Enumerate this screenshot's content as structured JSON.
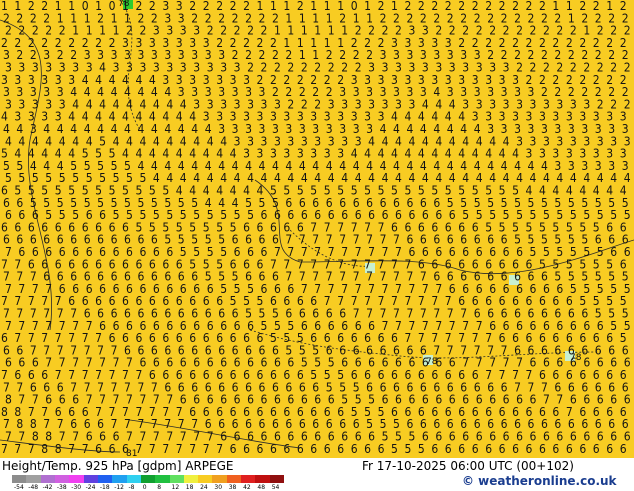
{
  "map": {
    "rows": [
      "1 1 2 2 1 1 0 1 0 1 2 2 3 3 2 2 2 2 2 1 1 1 2 1 1 1 0 1 2 1 2 2 2 2 2 2 2 2 2 2 2 1 1 2 2 1 2",
      "2 2 2 2 1 1 1 2 1 1 2 2 3 3 2 2 2 2 2 2 2 1 1 1 1 2 1 1 2 2 2 2 2 2 2 2 2 2 2 2 2 2 1 2 2 2 2",
      "2 2 2 2 2 1 1 1 1 2 2 3 3 3 3 2 2 2 2 2 1 1 1 1 1 1 2 2 2 2 3 3 2 2 2 2 2 2 2 2 2 2 2 1 2 2 2",
      "2 2 2 2 2 2 2 2 2 3 3 3 3 3 3 3 2 2 2 2 2 1 1 1 1 1 2 2 2 3 3 3 3 3 2 2 2 2 2 2 2 2 2 2 2 2 2",
      "3 2 2 3 2 2 3 3 3 3 3 3 3 3 3 3 3 2 2 2 2 2 1 1 2 2 2 2 3 3 3 3 3 3 3 3 2 2 2 2 2 2 2 2 2 2 2",
      "3 3 3 3 3 3 3 4 3 3 3 3 3 3 3 3 3 3 2 2 2 2 2 2 2 2 2 3 3 3 3 3 3 3 3 3 3 3 2 2 2 2 2 2 2 2 2",
      "3 3 3 3 3 3 4 4 4 4 4 4 3 3 3 3 3 3 3 2 2 2 2 2 2 2 3 3 3 3 3 3 3 3 3 3 3 3 3 2 2 2 2 2 2 2 2",
      "3 3 3 3 3 4 4 4 4 4 4 4 4 3 3 3 3 3 3 3 2 2 2 2 2 3 3 3 3 3 3 3 4 3 3 3 3 3 3 3 2 2 2 2 2 2 2",
      "3 3 3 3 3 4 4 4 4 4 4 4 4 4 3 3 3 3 3 3 3 2 2 2 3 3 3 3 3 3 3 4 4 4 3 3 3 3 3 3 3 3 3 3 2 2 2",
      "4 3 3 3 3 4 4 4 4 4 4 4 4 4 4 3 3 3 3 3 3 3 3 3 3 3 3 3 3 4 4 4 4 4 4 3 3 3 3 3 3 3 3 3 3 3 3",
      "4 4 3 4 4 4 4 4 4 4 4 4 4 4 4 4 3 3 3 3 3 3 3 3 3 3 3 3 4 4 4 4 4 4 4 4 3 3 3 3 3 3 3 3 3 3 3",
      "4 4 4 4 4 4 4 5 4 4 4 4 4 4 4 4 4 3 3 3 3 3 3 3 3 3 3 4 4 4 4 4 4 4 4 4 4 4 3 3 3 3 3 3 3 3 3",
      "5 4 4 4 4 4 5 5 5 4 4 4 4 4 4 4 4 4 3 3 3 3 3 3 3 3 4 4 4 4 4 4 4 4 4 4 4 4 4 3 3 3 3 3 3 3 3",
      "5 5 4 4 4 5 5 5 5 5 4 4 4 4 4 4 4 4 4 4 4 4 4 4 4 4 4 4 4 4 4 4 4 4 4 4 4 4 4 4 4 3 3 3 3 3 3",
      "5 5 5 5 5 5 5 5 5 5 5 4 4 4 4 4 4 4 4 4 4 4 4 4 4 4 4 4 4 4 4 4 4 4 4 4 4 4 4 4 4 4 4 4 4 4 4",
      "6 5 5 5 5 5 5 5 5 5 5 5 5 4 4 4 4 4 4 4 5 5 5 5 5 5 5 5 5 5 5 5 5 5 5 5 5 5 5 4 4 4 4 4 4 4 4",
      "6 6 5 5 5 5 5 5 5 5 5 5 5 5 5 4 4 4 5 5 5 6 6 6 6 6 6 6 6 6 6 6 6 5 5 5 5 5 5 5 5 5 5 5 5 5 5",
      "6 6 6 5 5 5 6 6 5 5 5 5 5 5 5 5 5 5 5 6 6 6 6 6 6 6 6 6 6 6 6 6 6 6 5 5 5 5 5 5 5 5 5 5 5 5 5",
      "6 6 6 6 6 6 6 6 6 6 5 5 5 5 5 5 5 5 6 6 6 6 6 7 7 7 7 7 7 6 6 6 6 6 6 6 5 5 5 5 5 5 5 5 5 6 6",
      "6 6 6 6 6 6 6 6 6 6 6 6 5 5 5 5 5 6 6 6 6 7 7 7 7 7 7 7 7 7 6 6 6 6 6 6 6 6 5 5 5 5 5 5 6 6 6",
      "7 6 6 6 6 6 6 6 6 6 6 6 6 5 5 5 5 6 6 6 7 7 7 7 7 7 7 7 7 7 6 6 6 6 6 6 6 6 6 5 5 5 5 5 5 6 6",
      "7 7 6 6 6 6 6 6 6 6 6 6 6 6 5 5 5 6 6 6 7 7 7 7 7 7 7 7 7 7 7 6 6 6 6 6 6 6 6 6 5 5 5 5 5 5 6",
      "7 7 7 6 6 6 6 6 6 6 6 6 6 6 6 5 5 5 6 6 6 7 7 7 7 7 7 7 7 7 7 7 6 6 6 6 6 6 6 6 6 5 5 5 5 5 5",
      "7 7 7 7 6 6 6 6 6 6 6 6 6 6 6 6 5 5 5 6 6 6 7 7 7 7 7 7 7 7 7 7 7 6 6 6 6 6 6 6 6 6 5 5 5 5 5",
      "7 7 7 7 7 6 6 6 6 6 6 6 6 6 6 6 6 5 5 5 6 6 6 6 7 7 7 7 7 7 7 7 7 7 6 6 6 6 6 6 6 6 6 5 5 5 5",
      "7 7 7 7 7 7 6 6 6 6 6 6 6 6 6 6 6 6 5 5 5 6 6 6 6 6 7 7 7 7 7 7 7 7 7 6 6 6 6 6 6 6 6 6 5 5 5",
      "7 7 7 7 7 7 7 6 6 6 6 6 6 6 6 6 6 6 6 5 5 5 6 6 6 6 6 6 7 7 7 7 7 7 7 7 6 6 6 6 6 6 6 6 6 5 5",
      "6 7 7 7 7 7 7 7 6 6 6 6 6 6 6 6 6 6 6 6 5 5 5 6 6 6 6 6 6 6 7 7 7 7 7 7 7 6 6 6 6 6 6 6 6 6 5",
      "6 6 7 7 7 7 7 7 7 6 6 6 6 6 6 6 6 6 6 6 6 5 5 5 6 6 6 6 6 6 6 6 7 7 7 7 7 7 6 6 6 6 6 6 6 6 6",
      "6 6 6 7 7 7 7 7 7 7 6 6 6 6 6 6 6 6 6 6 6 6 5 5 5 6 6 6 6 6 6 6 6 6 7 7 7 7 7 6 6 6 6 6 6 6 6",
      "7 6 6 6 7 7 7 7 7 7 7 6 6 6 6 6 6 6 6 6 6 6 6 5 5 5 6 6 6 6 6 6 6 6 6 6 7 7 7 7 6 6 6 6 6 6 6",
      "7 7 6 6 6 7 7 7 7 7 7 7 6 6 6 6 6 6 6 6 6 6 6 6 5 5 5 6 6 6 6 6 6 6 6 6 6 6 7 7 7 6 6 6 6 6 6",
      "8 7 7 6 6 6 7 7 7 7 7 7 7 6 6 6 6 6 6 6 6 6 6 6 6 5 5 5 6 6 6 6 6 6 6 6 6 6 6 6 7 7 6 6 6 6 6",
      "8 8 7 7 6 6 6 7 7 7 7 7 7 7 6 6 6 6 6 6 6 6 6 6 6 6 5 5 5 6 6 6 6 6 6 6 6 6 6 6 6 6 7 6 6 6 6",
      "7 8 8 7 7 6 6 6 7 7 7 7 7 7 7 6 6 6 6 6 6 6 6 6 6 6 6 5 5 5 6 6 6 6 6 6 6 6 6 6 6 6 6 6 6 6 6",
      "7 7 8 8 7 7 6 6 6 7 7 7 7 7 7 7 6 6 6 6 6 6 6 6 6 6 6 6 5 5 5 6 6 6 6 6 6 6 6 6 6 6 6 6 6 6 6",
      "7 7 7 8 8 7 7 6 6 6 7 7 7 7 7 7 7 6 6 6 6 6 6 6 6 6 6 6 6 5 5 5 6 6 6 6 6 6 6 6 6 6 6 6 6 6 6"
    ],
    "contour_labels": [
      "78",
      "78",
      "78",
      "81"
    ],
    "colors": {
      "background": "#f8cc22",
      "contour": "#2a2a2a",
      "green_marker": "#2ecc2e",
      "cyan_marker": "#c8f0d0"
    }
  },
  "footer": {
    "title": "Height/Temp. 925 hPa [gdpm] ARPEGE",
    "valid": "Fr 17-10-2025 06:00 UTC (00+102)",
    "credit": "© weatheronline.co.uk",
    "scale_ticks": [
      "-54",
      "-48",
      "-42",
      "-38",
      "-30",
      "-24",
      "-18",
      "-12",
      "-8",
      "0",
      "8",
      "12",
      "18",
      "24",
      "30",
      "38",
      "42",
      "48",
      "54"
    ],
    "scale_colors": [
      "#8c8c8c",
      "#a0a0a0",
      "#b070d0",
      "#d060e0",
      "#f040f0",
      "#6040e0",
      "#2060f0",
      "#20a0f0",
      "#30d0f0",
      "#10a030",
      "#20c040",
      "#60e060",
      "#f0f040",
      "#f8cc22",
      "#f0a020",
      "#f06020",
      "#e02020",
      "#c01010",
      "#901010"
    ]
  }
}
